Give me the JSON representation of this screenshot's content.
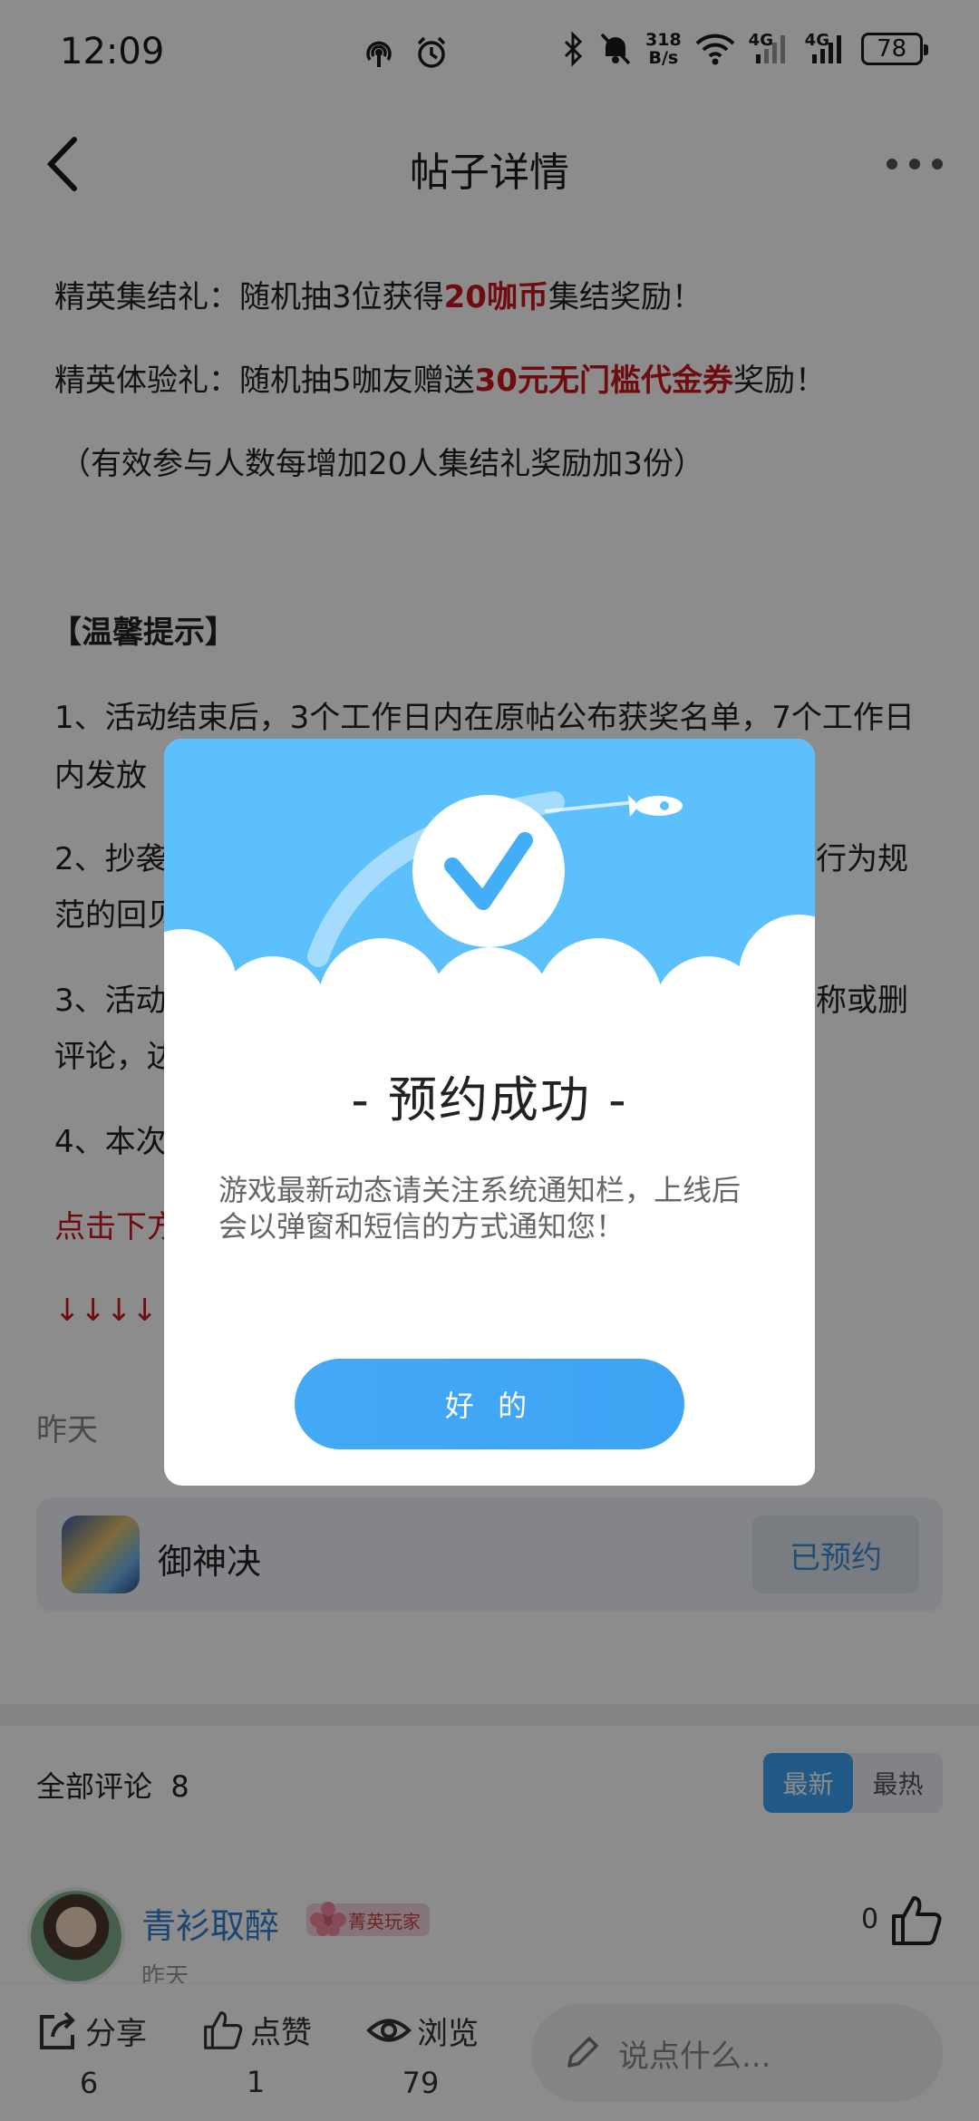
{
  "status_bar": {
    "time": "12:09",
    "net_speed_value": "318",
    "net_speed_unit": "B/s",
    "net1": "4G",
    "net2": "4G",
    "battery": "78"
  },
  "header": {
    "title": "帖子详情"
  },
  "article": {
    "line_prefix_1": "精英集结礼：随机抽3位获得",
    "line_red_1": "20咖币",
    "line_suffix_1": "集结奖励！",
    "line_prefix_2": "精英体验礼：随机抽5咖友赠送",
    "line_red_2": "30元无门槛代金券",
    "line_suffix_2": "奖励！",
    "note": "（有效参与人数每增加20人集结礼奖励加3份）",
    "tips_heading": "【温馨提示】",
    "tip1": "1、活动结束后，3个工作日内在原帖公布获奖名单，7个工作日内发放",
    "tip2_left": "2、抄袭",
    "tip2_right": "行为规",
    "tip2_line2": "范的回贝",
    "tip3_left": "3、活动",
    "tip3_right": "称或删",
    "tip3_line2": "评论，边",
    "tip4": "4、本次",
    "click_hint": "点击下方",
    "arrows": "↓↓↓↓"
  },
  "post_date": "昨天",
  "game_card": {
    "name": "御神决",
    "button": "已预约"
  },
  "comments": {
    "label": "全部评论",
    "count": "8",
    "sort_latest": "最新",
    "sort_hot": "最热",
    "items": [
      {
        "name": "青衫取醉",
        "badge": "菁英玩家",
        "date": "昨天",
        "likes": "0"
      }
    ]
  },
  "bottom_bar": {
    "share_label": "分享",
    "share_count": "6",
    "like_label": "点赞",
    "like_count": "1",
    "view_label": "浏览",
    "view_count": "79",
    "input_placeholder": "说点什么..."
  },
  "dialog": {
    "title": "- 预约成功 -",
    "message": "游戏最新动态请关注系统通知栏，上线后会以弹窗和短信的方式通知您！",
    "ok_button": "好 的"
  },
  "colors": {
    "accent": "#3da5f6",
    "red_text": "#c8161d",
    "dialog_sky": "#5bc0fb",
    "overlay": "rgba(0,0,0,0.45)"
  }
}
